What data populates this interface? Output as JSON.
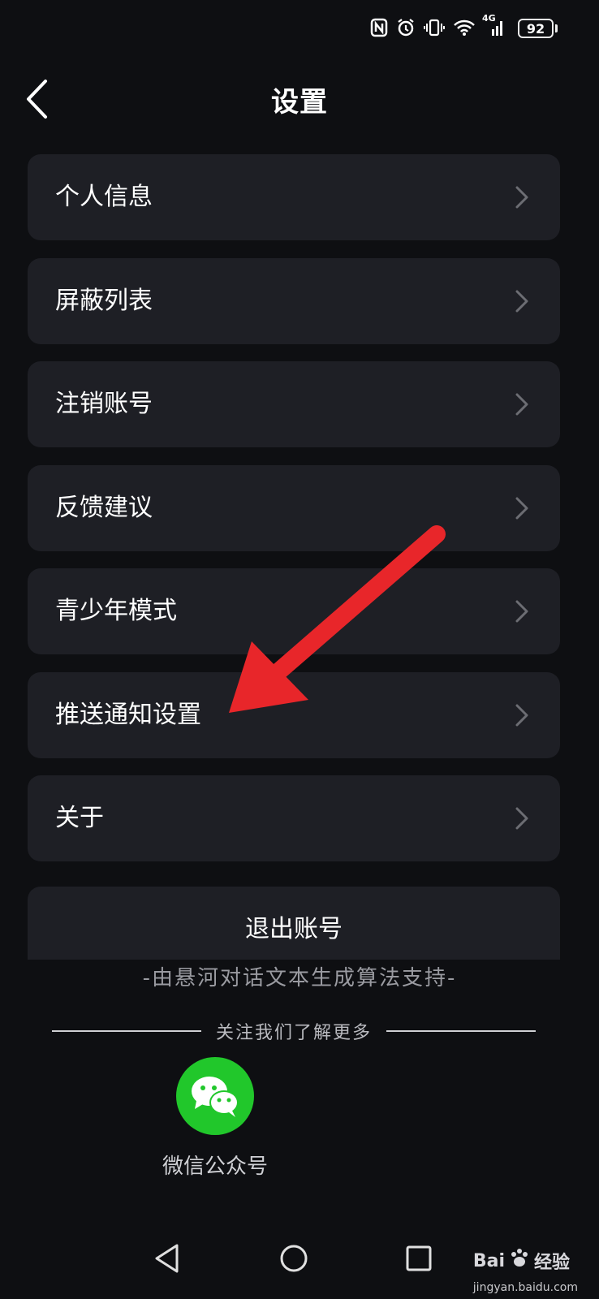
{
  "status_bar": {
    "battery": "92",
    "network": "4G"
  },
  "header": {
    "title": "设置"
  },
  "menu": {
    "items": [
      {
        "label": "个人信息"
      },
      {
        "label": "屏蔽列表"
      },
      {
        "label": "注销账号"
      },
      {
        "label": "反馈建议"
      },
      {
        "label": "青少年模式"
      },
      {
        "label": "推送通知设置"
      },
      {
        "label": "关于"
      }
    ]
  },
  "logout": {
    "label": "退出账号"
  },
  "footer": {
    "algo_note": "-由悬河对话文本生成算法支持-",
    "follow_text": "关注我们了解更多",
    "wechat_label": "微信公众号"
  },
  "watermark": {
    "brand": "Bai",
    "brand_suffix": "经验",
    "url": "jingyan.baidu.com"
  },
  "colors": {
    "background": "#0e0f12",
    "card": "#1e1f25",
    "wechat_green": "#21c72b",
    "annotation_arrow": "#e8262a"
  },
  "icons": [
    "nfc-icon",
    "alarm-icon",
    "vibrate-icon",
    "wifi-icon",
    "signal-icon",
    "back-arrow-icon",
    "chevron-right-icon",
    "wechat-icon",
    "nav-back-icon",
    "nav-home-icon",
    "nav-recents-icon"
  ]
}
